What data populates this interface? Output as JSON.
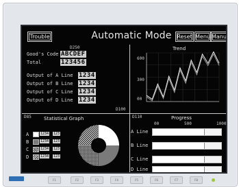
{
  "header": {
    "trouble_label": "Trouble",
    "title": "Automatic Mode",
    "reset_label": "Reset",
    "menu_label": "Menu",
    "manual_label": "Manua"
  },
  "codes": {
    "top": "D250",
    "right_bottom": "D100",
    "stat": "D85",
    "progress": "D110"
  },
  "goods": {
    "code_label": "Good's Code",
    "code_value": "ABCDEF",
    "total_label": "Total",
    "total_value": "123456"
  },
  "outputs": [
    {
      "label": "Output of A Line",
      "value": "1234"
    },
    {
      "label": "Output of B Line",
      "value": "1234"
    },
    {
      "label": "Output of C Line",
      "value": "1234"
    },
    {
      "label": "Output of D Line",
      "value": "1234"
    }
  ],
  "trend": {
    "title": "Trend",
    "y_ticks": [
      "600",
      "300",
      "00"
    ]
  },
  "chart_data": {
    "type": "line",
    "title": "Trend",
    "xlabel": "",
    "ylabel": "",
    "ylim": [
      0,
      600
    ],
    "x": [
      1,
      2,
      3,
      4,
      5,
      6,
      7,
      8,
      9,
      10,
      11,
      12,
      13,
      14
    ],
    "series": [
      {
        "values": [
          80,
          30,
          230,
          60,
          330,
          150,
          440,
          270,
          540,
          380,
          620,
          500,
          650,
          500
        ]
      },
      {
        "values": [
          60,
          10,
          200,
          40,
          300,
          120,
          410,
          240,
          510,
          350,
          590,
          470,
          620,
          470
        ]
      }
    ],
    "grid": true
  },
  "stat_graph": {
    "title": "Statistical Graph",
    "items": [
      {
        "label": "A",
        "v1": "1234",
        "v2": "123"
      },
      {
        "label": "B",
        "v1": "1234",
        "v2": "123"
      },
      {
        "label": "C",
        "v1": "1234",
        "v2": "123"
      },
      {
        "label": "D",
        "v1": "1234",
        "v2": "123"
      }
    ],
    "slices": [
      0.25,
      0.25,
      0.25,
      0.25
    ]
  },
  "progress": {
    "title": "Progress",
    "scale": [
      "00",
      "500",
      "1000"
    ],
    "rows": [
      {
        "label": "A Line",
        "fraction": 0.75
      },
      {
        "label": "B Line",
        "fraction": 0.75
      },
      {
        "label": "C Line",
        "fraction": 0.75
      },
      {
        "label": "D Line",
        "fraction": 0.75
      }
    ]
  },
  "bezel": {
    "keys": [
      "F1",
      "F2",
      "F3",
      "F4",
      "F5",
      "F6",
      "F7",
      "F8"
    ]
  }
}
